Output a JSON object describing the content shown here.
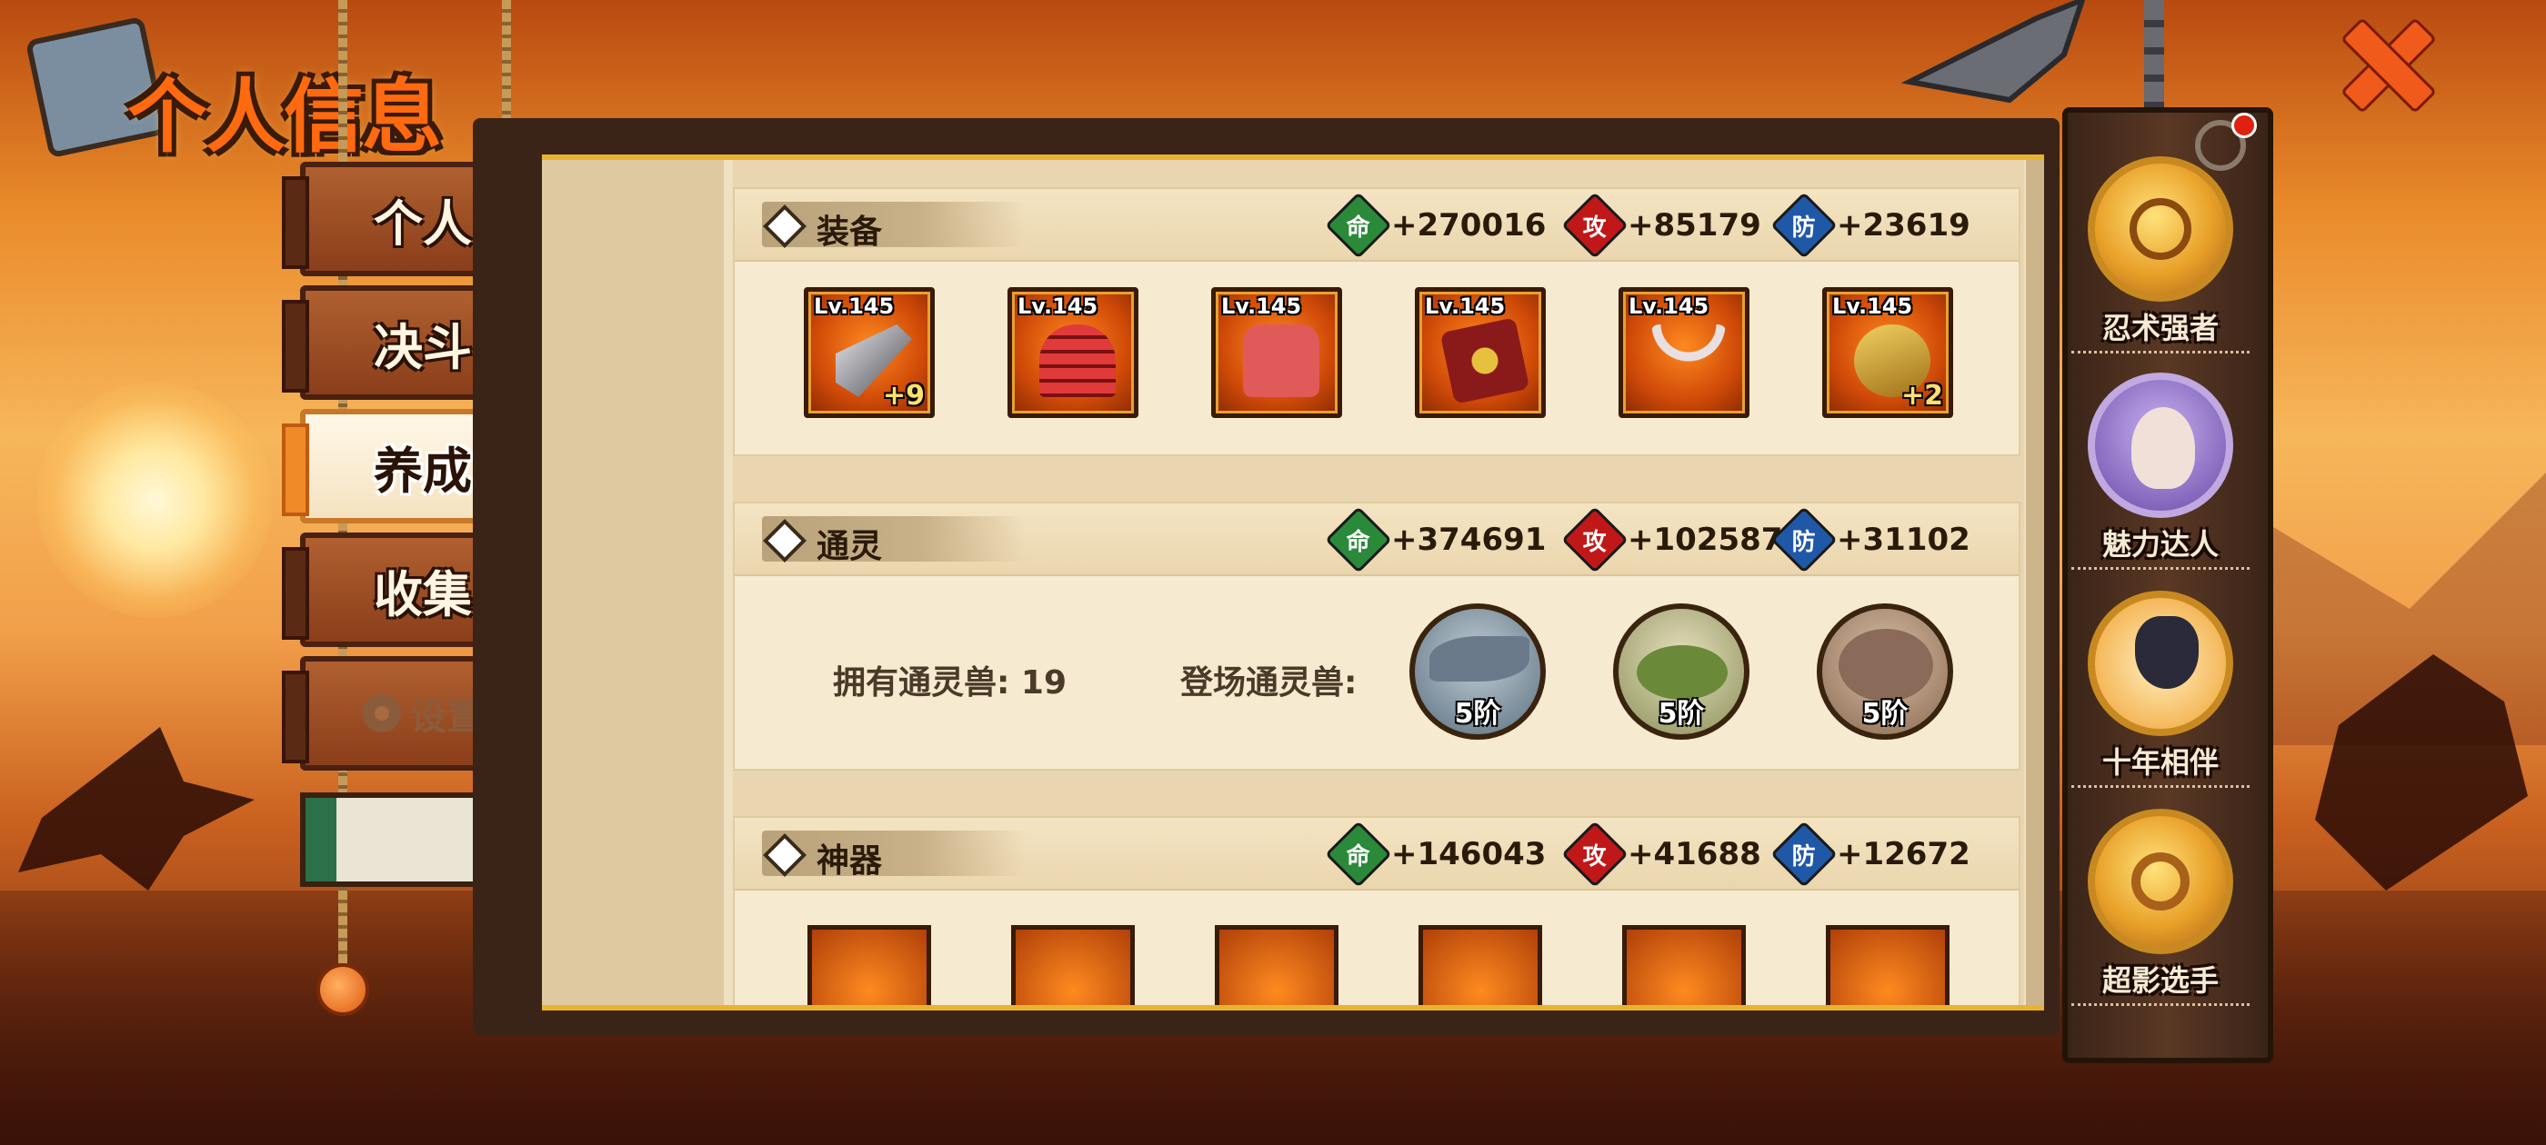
{
  "title": "个人信息",
  "nav": {
    "items": [
      {
        "label": "个人"
      },
      {
        "label": "决斗"
      },
      {
        "label": "养成"
      },
      {
        "label": "收集"
      },
      {
        "label": "设置"
      }
    ],
    "active": "养成"
  },
  "equipment": {
    "title": "装备",
    "stats": {
      "hp_label": "命",
      "hp": "+270016",
      "atk_label": "攻",
      "atk": "+85179",
      "def_label": "防",
      "def": "+23619"
    },
    "items": [
      {
        "level": "Lv.145",
        "plus": "+9",
        "icon": "cleaver-weapon-icon"
      },
      {
        "level": "Lv.145",
        "plus": "",
        "icon": "helmet-icon"
      },
      {
        "level": "Lv.145",
        "plus": "",
        "icon": "armor-icon"
      },
      {
        "level": "Lv.145",
        "plus": "",
        "icon": "scroll-book-icon"
      },
      {
        "level": "Lv.145",
        "plus": "",
        "icon": "claw-necklace-icon"
      },
      {
        "level": "Lv.145",
        "plus": "+2",
        "icon": "headband-icon"
      }
    ]
  },
  "summon": {
    "title": "通灵",
    "stats": {
      "hp_label": "命",
      "hp": "+374691",
      "atk_label": "攻",
      "atk": "+102587",
      "def_label": "防",
      "def": "+31102"
    },
    "owned_label": "拥有通灵兽: 19",
    "deployed_label": "登场通灵兽:",
    "beasts": [
      {
        "rank": "5阶",
        "icon": "shark-summon-icon"
      },
      {
        "rank": "5阶",
        "icon": "toad-summon-icon"
      },
      {
        "rank": "5阶",
        "icon": "rock-creature-icon"
      }
    ]
  },
  "artifact": {
    "title": "神器",
    "stats": {
      "hp_label": "命",
      "hp": "+146043",
      "atk_label": "攻",
      "atk": "+41688",
      "def_label": "防",
      "def": "+12672"
    }
  },
  "achievements": [
    {
      "label": "忍术强者",
      "icon": "ninja-medal-icon"
    },
    {
      "label": "魅力达人",
      "icon": "character-portrait-icon"
    },
    {
      "label": "十年相伴",
      "icon": "anniversary-portrait-icon"
    },
    {
      "label": "超影选手",
      "icon": "golden-medal-icon"
    }
  ],
  "colors": {
    "accent": "#f08a28",
    "hp": "#2a8a3a",
    "atk": "#c01818",
    "def": "#2058a8"
  }
}
